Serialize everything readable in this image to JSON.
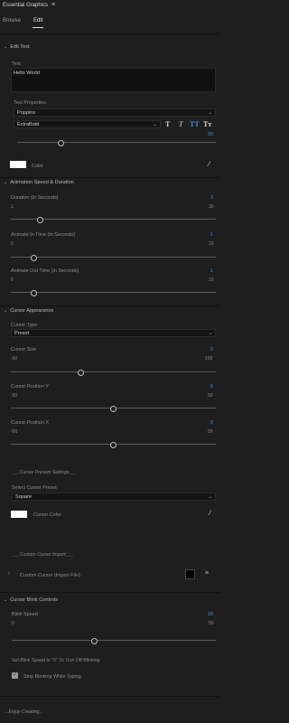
{
  "panel": {
    "title": "Essential Graphics",
    "menu_icon": "hamburger-icon"
  },
  "tabs": [
    {
      "label": "Browse"
    },
    {
      "label": "Edit"
    }
  ],
  "edit_text": {
    "header": "Edit Text",
    "text_label": "Text",
    "text_value": "Hello World",
    "props_label": "Text Properties",
    "font": "Poppins",
    "weight": "ExtraBold",
    "style_buttons": [
      "T",
      "T",
      "TT",
      "Tт"
    ],
    "size_value": "90",
    "size_fraction": 0.29,
    "color_label": "Color",
    "color_swatch": "#ffffff"
  },
  "animation": {
    "header": "Animation Speed & Duration",
    "duration": {
      "label": "Duration (In Seconds)",
      "value": "3",
      "min": "1",
      "max": "30"
    },
    "anim_in": {
      "label": "Animate In Time (In Seconds)",
      "value": "1",
      "min": "0",
      "max": "10"
    },
    "anim_out": {
      "label": "Animate Out Time (In Seconds)",
      "value": "1",
      "min": "0",
      "max": "10"
    }
  },
  "cursor": {
    "header": "Cursor Appearance",
    "type_label": "Cursor Type",
    "type_value": "Preset",
    "size": {
      "label": "Cursor Size",
      "value": "0",
      "min": "-50",
      "max": "100"
    },
    "pos_y": {
      "label": "Cursor Position Y",
      "value": "0",
      "min": "-50",
      "max": "50"
    },
    "pos_x": {
      "label": "Cursor Position X",
      "value": "0",
      "min": "-50",
      "max": "50"
    },
    "preset_settings_label": "___Cursor Presets Settings___",
    "select_preset_label": "Select Cursor Preset",
    "preset_value": "Square",
    "cursor_color_label": "Cursor Color",
    "custom_import_label": "___Custom Cursor Import___",
    "custom_cursor_label": "Custom Cursor (Import File)"
  },
  "blink": {
    "header": "Cursor Blink Controls",
    "speed": {
      "label": "Blink Speed",
      "value": "20",
      "min": "0",
      "max": "50"
    },
    "hint": "Set Blink Speed to \"0\" To Turn Off Blinking",
    "stop_label": "Stop Blinking While Typing"
  },
  "footer": "...Enjoy Creating..."
}
